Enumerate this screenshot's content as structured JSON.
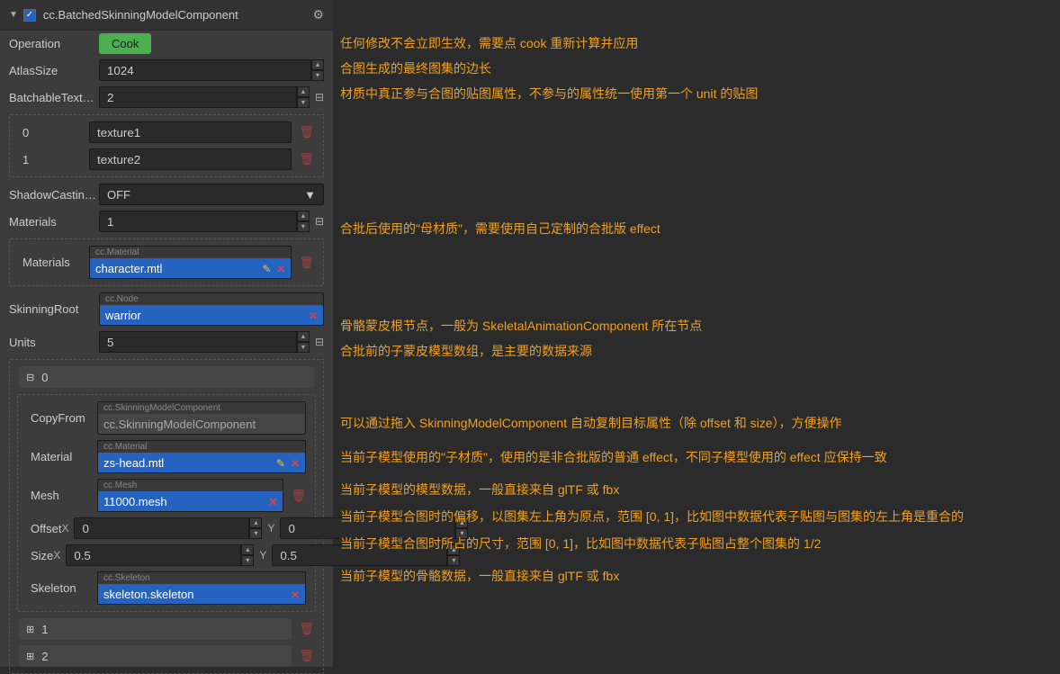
{
  "header": {
    "title": "cc.BatchedSkinningModelComponent",
    "checked": true
  },
  "fields": {
    "operation": {
      "label": "Operation",
      "button": "Cook"
    },
    "atlasSize": {
      "label": "AtlasSize",
      "value": "1024"
    },
    "batchableTex": {
      "label": "BatchableTextur...",
      "value": "2",
      "items": [
        {
          "idx": "0",
          "val": "texture1"
        },
        {
          "idx": "1",
          "val": "texture2"
        }
      ]
    },
    "shadowCasting": {
      "label": "ShadowCasting...",
      "value": "OFF"
    },
    "materials": {
      "label": "Materials",
      "value": "1",
      "sub": {
        "label": "Materials",
        "tag": "cc.Material",
        "val": "character.mtl"
      }
    },
    "skinningRoot": {
      "label": "SkinningRoot",
      "tag": "cc.Node",
      "val": "warrior"
    },
    "units": {
      "label": "Units",
      "value": "5"
    }
  },
  "unit0": {
    "idx": "0",
    "copyFrom": {
      "label": "CopyFrom",
      "tag": "cc.SkinningModelComponent",
      "val": "cc.SkinningModelComponent"
    },
    "material": {
      "label": "Material",
      "tag": "cc.Material",
      "val": "zs-head.mtl"
    },
    "mesh": {
      "label": "Mesh",
      "tag": "cc.Mesh",
      "val": "11000.mesh"
    },
    "offset": {
      "label": "Offset",
      "x": "0",
      "y": "0"
    },
    "size": {
      "label": "Size",
      "x": "0.5",
      "y": "0.5"
    },
    "skeleton": {
      "label": "Skeleton",
      "tag": "cc.Skeleton",
      "val": "skeleton.skeleton"
    }
  },
  "unit1": {
    "idx": "1"
  },
  "unit2": {
    "idx": "2"
  },
  "annotations": {
    "a1": "任何修改不会立即生效，需要点 cook 重新计算并应用",
    "a2": "合图生成的最终图集的边长",
    "a3": "材质中真正参与合图的贴图属性，不参与的属性统一使用第一个 unit 的贴图",
    "a4": "合批后使用的\"母材质\"，需要使用自己定制的合批版 effect",
    "a5": "骨骼蒙皮根节点，一般为 SkeletalAnimationComponent 所在节点",
    "a6": "合批前的子蒙皮模型数组，是主要的数据来源",
    "a7": "可以通过拖入 SkinningModelComponent 自动复制目标属性（除 offset 和 size），方便操作",
    "a8": "当前子模型使用的\"子材质\"，使用的是非合批版的普通 effect，不同子模型使用的 effect 应保持一致",
    "a9": "当前子模型的模型数据，一般直接来自 glTF 或 fbx",
    "a10": "当前子模型合图时的偏移，以图集左上角为原点，范围 [0, 1]，比如图中数据代表子贴图与图集的左上角是重合的",
    "a11": "当前子模型合图时所占的尺寸，范围 [0, 1]，比如图中数据代表子贴图占整个图集的 1/2",
    "a12": "当前子模型的骨骼数据，一般直接来自 glTF 或 fbx"
  }
}
